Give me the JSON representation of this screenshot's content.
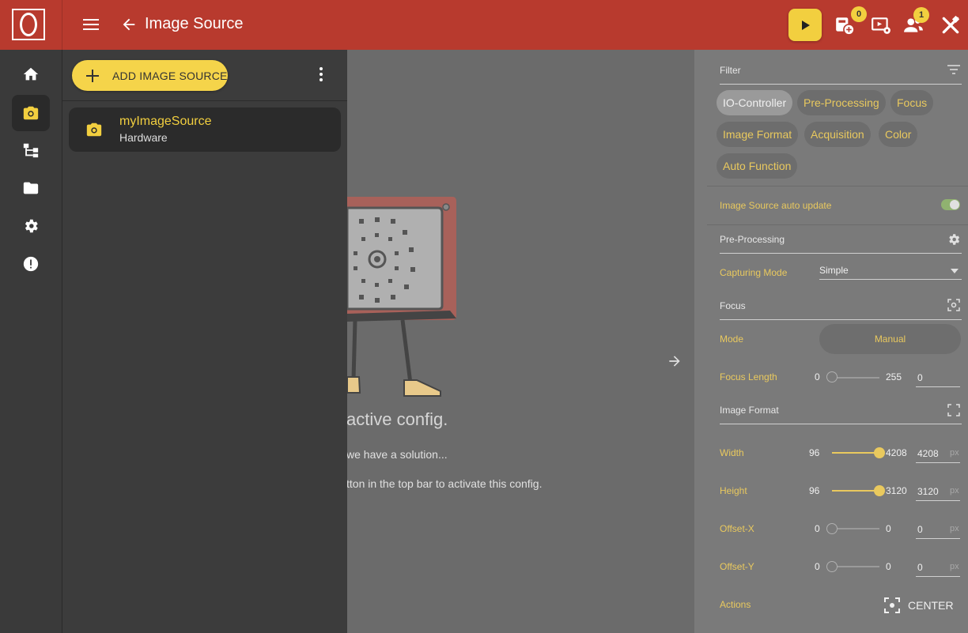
{
  "header": {
    "title": "Image Source",
    "badges": {
      "connection": "0",
      "users": "1"
    }
  },
  "drawer": {
    "add_label": "ADD IMAGE SOURCE",
    "items": [
      {
        "name": "myImageSource",
        "type": "Hardware"
      }
    ]
  },
  "center": {
    "message_title": "active config.",
    "message_line1": "we have a solution...",
    "message_line2": "tton in the top bar to activate this config."
  },
  "panel": {
    "filter_label": "Filter",
    "chips": [
      "IO-Controller",
      "Pre-Processing",
      "Focus",
      "Image Format",
      "Acquisition",
      "Color",
      "Auto Function"
    ],
    "selected_chip": "IO-Controller",
    "auto_update": {
      "label": "Image Source auto update",
      "enabled": true
    },
    "pre_processing": {
      "title": "Pre-Processing",
      "capturing_mode_label": "Capturing Mode",
      "capturing_mode_value": "Simple"
    },
    "focus": {
      "title": "Focus",
      "mode_label": "Mode",
      "mode_value": "Manual",
      "length_label": "Focus Length",
      "length_min": "0",
      "length_max": "255",
      "length_value": "0"
    },
    "image_format": {
      "title": "Image Format",
      "width": {
        "label": "Width",
        "min": "96",
        "max": "4208",
        "value": "4208",
        "unit": "px"
      },
      "height": {
        "label": "Height",
        "min": "96",
        "max": "3120",
        "value": "3120",
        "unit": "px"
      },
      "offset_x": {
        "label": "Offset-X",
        "min": "0",
        "max": "0",
        "value": "0",
        "unit": "px"
      },
      "offset_y": {
        "label": "Offset-Y",
        "min": "0",
        "max": "0",
        "value": "0",
        "unit": "px"
      },
      "actions_label": "Actions",
      "center_label": "CENTER"
    }
  },
  "colors": {
    "accent": "#f2cf3f",
    "topbar": "#b83a2e",
    "rail": "#3a3a3a"
  }
}
